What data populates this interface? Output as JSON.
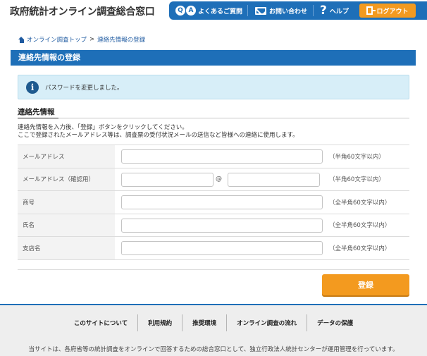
{
  "header": {
    "site_title": "政府統計オンライン調査総合窓口",
    "faq_label": "よくあるご質問",
    "faq_icon_letters": [
      "Q",
      "A"
    ],
    "contact_label": "お問い合わせ",
    "help_glyph": "?",
    "help_label": "ヘルプ",
    "logout_label": "ログアウト",
    "nav_color": "#1e6fb8",
    "logout_color": "#f39a1f"
  },
  "breadcrumb": {
    "home": "オンライン調査トップ",
    "separator": ">",
    "current": "連絡先情報の登録"
  },
  "page_title": "連絡先情報の登録",
  "notice": {
    "icon": "info-icon",
    "text": "パスワードを変更しました。"
  },
  "section": {
    "title": "連絡先情報",
    "desc_line1": "連絡先情報を入力後、「登録」ボタンをクリックしてください。",
    "desc_line2": "ここで登録されたメールアドレス等は、調査票の受付状況メールの送信など皆様への連絡に使用します。"
  },
  "form": {
    "email_label": "メールアドレス",
    "email_value": "",
    "email_hint": "（半角60文字以内）",
    "email_confirm_label": "メールアドレス（確認用）",
    "email_confirm_local": "",
    "email_confirm_at": "@",
    "email_confirm_domain": "",
    "email_confirm_hint": "（半角60文字以内）",
    "company_label": "商号",
    "company_value": "",
    "company_hint": "（全半角60文字以内）",
    "name_label": "氏名",
    "name_value": "",
    "name_hint": "（全半角60文字以内）",
    "branch_label": "支店名",
    "branch_value": "",
    "branch_hint": "（全半角60文字以内）"
  },
  "submit_label": "登録",
  "footer": {
    "links": [
      "このサイトについて",
      "利用規約",
      "推奨環境",
      "オンライン調査の流れ",
      "データの保護"
    ],
    "note": "当サイトは、各府省等の統計調査をオンラインで回答するための総合窓口として、独立行政法人統計センターが運用管理を行っています。"
  }
}
